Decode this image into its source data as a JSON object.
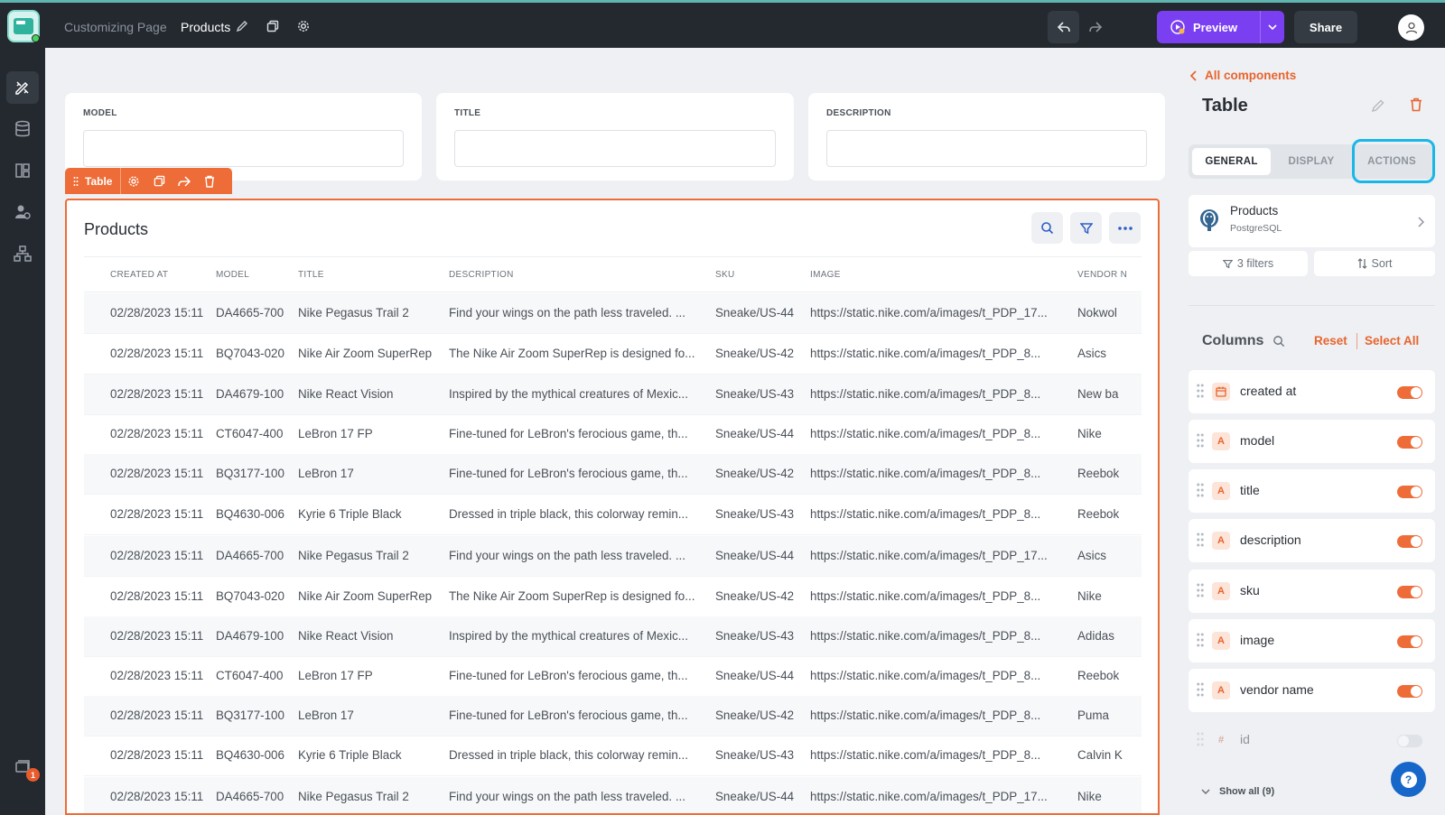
{
  "header": {
    "breadcrumb": "Customizing Page",
    "page_name": "Products",
    "preview_label": "Preview",
    "share_label": "Share"
  },
  "nav": {
    "notification_count": "1"
  },
  "filters": [
    {
      "label": "MODEL",
      "value": ""
    },
    {
      "label": "TITLE",
      "value": ""
    },
    {
      "label": "DESCRIPTION",
      "value": ""
    }
  ],
  "component_toolbar": {
    "label": "Table"
  },
  "table": {
    "title": "Products",
    "columns": [
      "CREATED AT",
      "MODEL",
      "TITLE",
      "DESCRIPTION",
      "SKU",
      "IMAGE",
      "VENDOR N"
    ],
    "rows": [
      [
        "02/28/2023 15:11",
        "DA4665-700",
        "Nike Pegasus Trail 2",
        "Find your wings on the path less traveled. ...",
        "Sneake/US-44",
        "https://static.nike.com/a/images/t_PDP_17...",
        "Nokwol"
      ],
      [
        "02/28/2023 15:11",
        "BQ7043-020",
        "Nike Air Zoom SuperRep",
        "The Nike Air Zoom SuperRep is designed fo...",
        "Sneake/US-42",
        "https://static.nike.com/a/images/t_PDP_8...",
        "Asics"
      ],
      [
        "02/28/2023 15:11",
        "DA4679-100",
        "Nike React Vision",
        "Inspired by the mythical creatures of Mexic...",
        "Sneake/US-43",
        "https://static.nike.com/a/images/t_PDP_8...",
        "New ba"
      ],
      [
        "02/28/2023 15:11",
        "CT6047-400",
        "LeBron 17 FP",
        "Fine-tuned for LeBron's ferocious game, th...",
        "Sneake/US-44",
        "https://static.nike.com/a/images/t_PDP_8...",
        "Nike"
      ],
      [
        "02/28/2023 15:11",
        "BQ3177-100",
        "LeBron 17",
        "Fine-tuned for LeBron's ferocious game, th...",
        "Sneake/US-42",
        "https://static.nike.com/a/images/t_PDP_8...",
        "Reebok"
      ],
      [
        "02/28/2023 15:11",
        "BQ4630-006",
        "Kyrie 6 Triple Black",
        "Dressed in triple black, this colorway remin...",
        "Sneake/US-43",
        "https://static.nike.com/a/images/t_PDP_8...",
        "Reebok"
      ],
      [
        "02/28/2023 15:11",
        "DA4665-700",
        "Nike Pegasus Trail 2",
        "Find your wings on the path less traveled. ...",
        "Sneake/US-44",
        "https://static.nike.com/a/images/t_PDP_17...",
        "Asics"
      ],
      [
        "02/28/2023 15:11",
        "BQ7043-020",
        "Nike Air Zoom SuperRep",
        "The Nike Air Zoom SuperRep is designed fo...",
        "Sneake/US-42",
        "https://static.nike.com/a/images/t_PDP_8...",
        "Nike"
      ],
      [
        "02/28/2023 15:11",
        "DA4679-100",
        "Nike React Vision",
        "Inspired by the mythical creatures of Mexic...",
        "Sneake/US-43",
        "https://static.nike.com/a/images/t_PDP_8...",
        "Adidas"
      ],
      [
        "02/28/2023 15:11",
        "CT6047-400",
        "LeBron 17 FP",
        "Fine-tuned for LeBron's ferocious game, th...",
        "Sneake/US-44",
        "https://static.nike.com/a/images/t_PDP_8...",
        "Reebok"
      ],
      [
        "02/28/2023 15:11",
        "BQ3177-100",
        "LeBron 17",
        "Fine-tuned for LeBron's ferocious game, th...",
        "Sneake/US-42",
        "https://static.nike.com/a/images/t_PDP_8...",
        "Puma"
      ],
      [
        "02/28/2023 15:11",
        "BQ4630-006",
        "Kyrie 6 Triple Black",
        "Dressed in triple black, this colorway remin...",
        "Sneake/US-43",
        "https://static.nike.com/a/images/t_PDP_8...",
        "Calvin K"
      ],
      [
        "02/28/2023 15:11",
        "DA4665-700",
        "Nike Pegasus Trail 2",
        "Find your wings on the path less traveled. ...",
        "Sneake/US-44",
        "https://static.nike.com/a/images/t_PDP_17...",
        "Nike"
      ]
    ]
  },
  "panel": {
    "back_label": "All components",
    "title": "Table",
    "tabs": [
      "GENERAL",
      "DISPLAY",
      "ACTIONS"
    ],
    "active_tab": "GENERAL",
    "source": {
      "name": "Products",
      "type": "PostgreSQL"
    },
    "filters_label": "3 filters",
    "sort_label": "Sort",
    "columns_heading": "Columns",
    "reset_label": "Reset",
    "select_all_label": "Select All",
    "columns": [
      {
        "name": "created at",
        "icon": "calendar-icon",
        "type_glyph": "",
        "enabled": true
      },
      {
        "name": "model",
        "icon": "text-type-icon",
        "type_glyph": "A",
        "enabled": true
      },
      {
        "name": "title",
        "icon": "text-type-icon",
        "type_glyph": "A",
        "enabled": true
      },
      {
        "name": "description",
        "icon": "text-type-icon",
        "type_glyph": "A",
        "enabled": true
      },
      {
        "name": "sku",
        "icon": "text-type-icon",
        "type_glyph": "A",
        "enabled": true
      },
      {
        "name": "image",
        "icon": "text-type-icon",
        "type_glyph": "A",
        "enabled": true
      },
      {
        "name": "vendor name",
        "icon": "text-type-icon",
        "type_glyph": "A",
        "enabled": true
      },
      {
        "name": "id",
        "icon": "number-type-icon",
        "type_glyph": "#",
        "enabled": false
      }
    ],
    "show_all_label": "Show all (9)"
  },
  "colors": {
    "accent": "#ee6c37",
    "primary": "#7b3ff2",
    "highlight": "#19b7e8",
    "topbar": "#24292f"
  }
}
